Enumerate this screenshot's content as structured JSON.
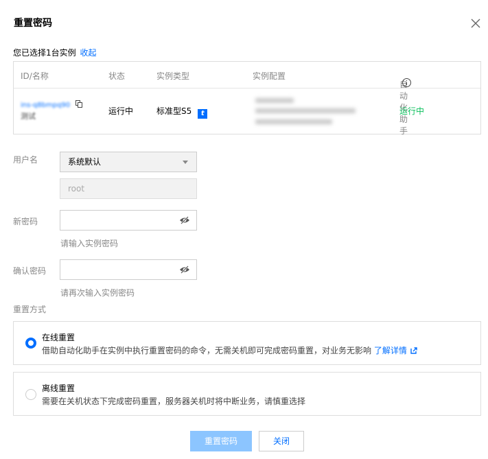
{
  "dialog": {
    "title": "重置密码",
    "close_icon": "close-icon"
  },
  "selection": {
    "text": "您已选择1台实例",
    "toggle_link": "收起"
  },
  "table": {
    "headers": {
      "id_name": "ID/名称",
      "status": "状态",
      "instance_type": "实例类型",
      "config": "实例配置",
      "automation": "自动化助手"
    },
    "row": {
      "instance_id": "ins-q8bmpq90",
      "instance_name": "测试",
      "status": "运行中",
      "instance_type": "标准型S5",
      "type_badge": "t",
      "automation_status": "运行中"
    }
  },
  "form": {
    "username_label": "用户名",
    "username_select": "系统默认",
    "username_value": "root",
    "new_password_label": "新密码",
    "new_password_hint": "请输入实例密码",
    "confirm_password_label": "确认密码",
    "confirm_password_hint": "请再次输入实例密码",
    "reset_method_label": "重置方式"
  },
  "options": {
    "online": {
      "title": "在线重置",
      "desc": "借助自动化助手在实例中执行重置密码的命令，无需关机即可完成密码重置，对业务无影响",
      "link": "了解详情",
      "selected": true
    },
    "offline": {
      "title": "离线重置",
      "desc": "需要在关机状态下完成密码重置，服务器关机时将中断业务，请慎重选择",
      "selected": false
    }
  },
  "buttons": {
    "submit": "重置密码",
    "close": "关闭"
  },
  "colors": {
    "accent": "#006eff",
    "success": "#0abf5b",
    "primary_disabled": "#8cc5ff"
  }
}
